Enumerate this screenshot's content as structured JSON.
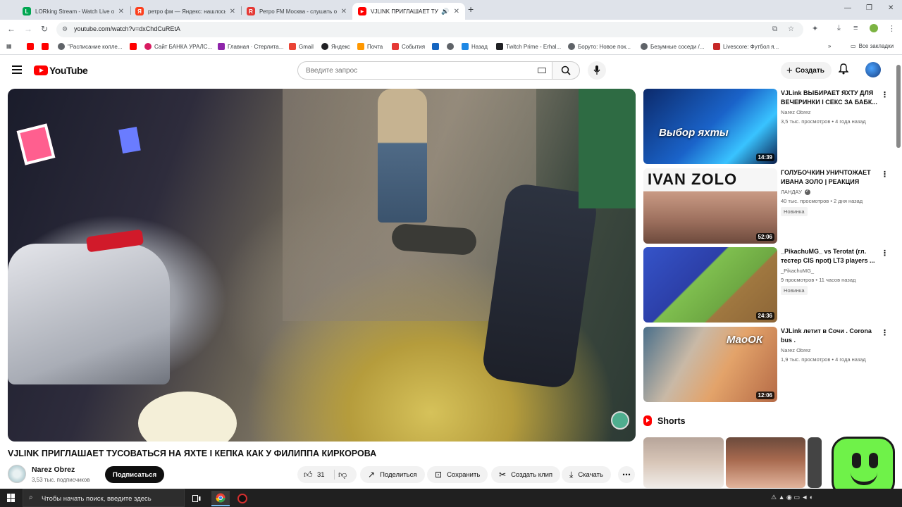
{
  "browser": {
    "tabs": [
      {
        "title": "LORking Stream - Watch Live o",
        "favicon_color": "#00a651",
        "favicon_glyph": "L"
      },
      {
        "title": "ретро фм — Яндекс: нашлось",
        "favicon_color": "#fc3f1d",
        "favicon_glyph": "Я"
      },
      {
        "title": "Ретро FM Москва - слушать о",
        "favicon_color": "#e53935",
        "favicon_glyph": "R"
      },
      {
        "title": "VJLINK ПРИГЛАШАЕТ ТУСО",
        "favicon_color": "#ff0000",
        "favicon_glyph": "▶"
      }
    ],
    "url": "youtube.com/watch?v=dxChdCuREtA",
    "bookmarks": [
      {
        "label": "",
        "color": "#ff0000"
      },
      {
        "label": "",
        "color": "#ff0000"
      },
      {
        "label": "\"Расписание колле...",
        "color": "#5f6368"
      },
      {
        "label": "",
        "color": "#ff0000"
      },
      {
        "label": "Сайт БАНКА УРАЛС...",
        "color": "#d81b60"
      },
      {
        "label": "Главная · Стерлита...",
        "color": "#8e24aa"
      },
      {
        "label": "Gmail",
        "color": "#ea4335"
      },
      {
        "label": "Яндекс",
        "color": "#202124"
      },
      {
        "label": "Почта",
        "color": "#ff9800"
      },
      {
        "label": "События",
        "color": "#e53935"
      },
      {
        "label": "",
        "color": "#1565c0"
      },
      {
        "label": "",
        "color": "#5f6368"
      },
      {
        "label": "Назад",
        "color": "#1e88e5"
      },
      {
        "label": "Twitch Prime - Erhal...",
        "color": "#202124"
      },
      {
        "label": "Боруто: Новое пок...",
        "color": "#5f6368"
      },
      {
        "label": "Безумные соседи /...",
        "color": "#5f6368"
      },
      {
        "label": "Livescore: Футбол я...",
        "color": "#c62828"
      }
    ],
    "all_bookmarks": "Все закладки"
  },
  "youtube": {
    "logo_text": "YouTube",
    "search_placeholder": "Введите запрос",
    "create_label": "Создать",
    "video": {
      "title": "VJLINK ПРИГЛАШАЕТ ТУСОВАТЬСЯ НА ЯХТЕ I КЕПКА КАК У ФИЛИППА КИРКОРОВА",
      "channel": "Narez Obrez",
      "subscribers": "3,53 тыс. подписчиков",
      "subscribe_label": "Подписаться",
      "likes": "31",
      "share_label": "Поделиться",
      "save_label": "Сохранить",
      "clip_label": "Создать клип",
      "download_label": "Скачать"
    },
    "recommendations": [
      {
        "title": "VJLink ВЫБИРАЕТ ЯХТУ ДЛЯ ВЕЧЕРИНКИ I СЕКС ЗА БАБК...",
        "channel": "Narez Obrez",
        "meta": "3,5 тыс. просмотров • 4 года назад",
        "duration": "14:39",
        "thumb_text": "Выбор яхты",
        "verified": false,
        "badge": ""
      },
      {
        "title": "ГОЛУБОЧКИН УНИЧТОЖАЕТ ИВАНА ЗОЛО | РЕАКЦИЯ",
        "channel": "ЛАНДАУ",
        "meta": "40 тыс. просмотров • 2 дня назад",
        "duration": "52:06",
        "thumb_text": "IVAN ZOLO",
        "verified": true,
        "badge": "Новинка"
      },
      {
        "title": "_PikachuMG_ vs Terotat (гл. тестер CIS npot) LT3 players ...",
        "channel": "_PikachuMG_",
        "meta": "9 просмотров • 11 часов назад",
        "duration": "24:36",
        "thumb_text": "",
        "verified": false,
        "badge": "Новинка"
      },
      {
        "title": "VJLink летит в Сочи . Corona bus .",
        "channel": "Narez Obrez",
        "meta": "1,9 тыс. просмотров • 4 года назад",
        "duration": "12:06",
        "thumb_text": "МаоОК",
        "verified": false,
        "badge": ""
      }
    ],
    "shorts_label": "Shorts"
  },
  "taskbar": {
    "search_placeholder": "Чтобы начать поиск, введите здесь"
  }
}
